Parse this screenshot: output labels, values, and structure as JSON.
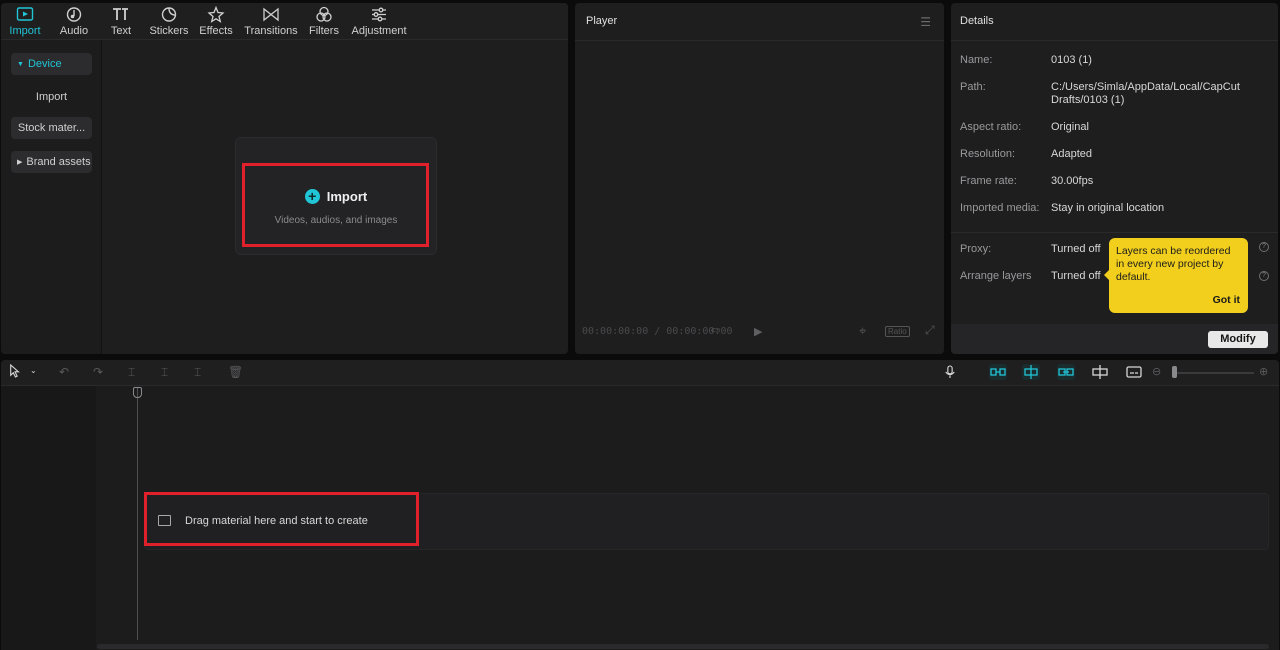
{
  "media_toolbar": {
    "tabs": [
      {
        "label": "Import",
        "icon": "import-icon"
      },
      {
        "label": "Audio",
        "icon": "audio-icon"
      },
      {
        "label": "Text",
        "icon": "text-icon"
      },
      {
        "label": "Stickers",
        "icon": "stickers-icon"
      },
      {
        "label": "Effects",
        "icon": "effects-icon"
      },
      {
        "label": "Transitions",
        "icon": "transitions-icon"
      },
      {
        "label": "Filters",
        "icon": "filters-icon"
      },
      {
        "label": "Adjustment",
        "icon": "adjustment-icon"
      }
    ],
    "active_tab": "Import"
  },
  "sidebar": {
    "items": [
      {
        "label": "Device"
      },
      {
        "label": "Import"
      },
      {
        "label": "Stock mater..."
      },
      {
        "label": "Brand assets"
      }
    ]
  },
  "import_box": {
    "title": "Import",
    "subtitle": "Videos, audios, and images"
  },
  "player": {
    "title": "Player",
    "timecode": "00:00:00:00 / 00:00:00:00",
    "ratio_label": "Ratio"
  },
  "details": {
    "title": "Details",
    "rows": [
      {
        "label": "Name:",
        "value": "0103 (1)"
      },
      {
        "label": "Path:",
        "value": "C:/Users/Simla/AppData/Local/CapCut Drafts/0103 (1)"
      },
      {
        "label": "Aspect ratio:",
        "value": "Original"
      },
      {
        "label": "Resolution:",
        "value": "Adapted"
      },
      {
        "label": "Frame rate:",
        "value": "30.00fps"
      },
      {
        "label": "Imported media:",
        "value": "Stay in original location"
      },
      {
        "label": "Proxy:",
        "value": "Turned off"
      },
      {
        "label": "Arrange layers",
        "value": "Turned off"
      }
    ],
    "tooltip_text": "Layers can be reordered in every new project by default.",
    "tooltip_button": "Got it",
    "modify_button": "Modify"
  },
  "timeline": {
    "drag_hint": "Drag material here and start to create"
  },
  "colors": {
    "accent": "#20c5d6",
    "highlight": "#e0202a",
    "tooltip": "#f2cf1d"
  }
}
